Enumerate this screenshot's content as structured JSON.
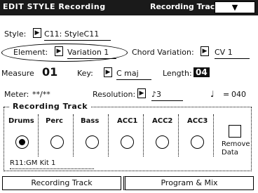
{
  "header": {
    "title": "EDIT STYLE Recording",
    "mode_title": "Recording Track",
    "dropdown": "▼"
  },
  "fields": {
    "style_label": "Style:",
    "style_value": "C11: StyleC11",
    "element_label": "Element:",
    "element_value": "Variation 1",
    "chord_variation_label": "Chord Variation:",
    "chord_variation_value": "CV 1",
    "measure_label": "Measure",
    "measure_value": "01",
    "key_label": "Key:",
    "key_value": "C maj",
    "length_label": "Length:",
    "length_value": "04",
    "meter_label": "Meter:",
    "meter_value": "**/**",
    "resolution_label": "Resolution:",
    "resolution_value": "♪3",
    "tempo_symbol": "♩",
    "tempo_eq": "=",
    "tempo_value": "040"
  },
  "recording_track": {
    "title": "Recording Track",
    "tracks": [
      {
        "label": "Drums",
        "selected": true
      },
      {
        "label": "Perc",
        "selected": false
      },
      {
        "label": "Bass",
        "selected": false
      },
      {
        "label": "ACC1",
        "selected": false
      },
      {
        "label": "ACC2",
        "selected": false
      },
      {
        "label": "ACC3",
        "selected": false
      }
    ],
    "remove_data_label": "Remove\nData",
    "status_text": "R11:GM Kit 1"
  },
  "tabs": [
    {
      "label": "Recording Track",
      "active": true
    },
    {
      "label": "Program & Mix",
      "active": false
    }
  ],
  "icons": {
    "arrow": "▶"
  }
}
